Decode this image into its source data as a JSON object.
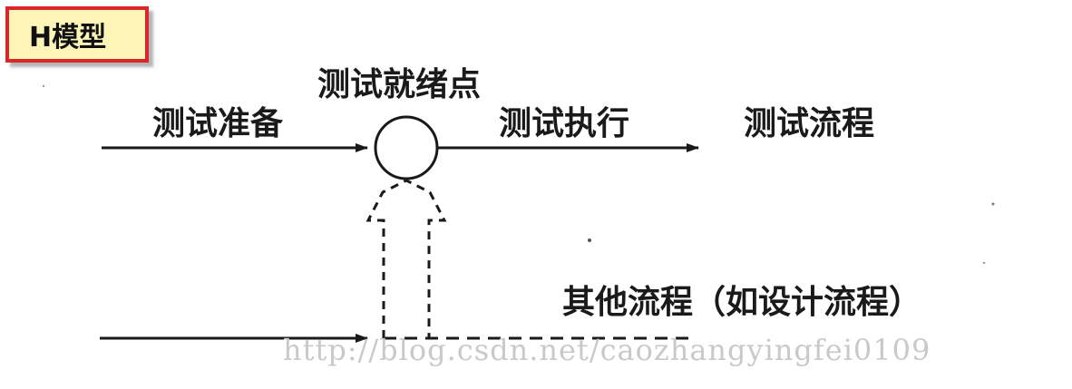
{
  "title": "H模型",
  "labels": {
    "test_ready_point": "测试就绪点",
    "test_prep": "测试准备",
    "test_exec": "测试执行",
    "test_flow": "测试流程",
    "other_flow": "其他流程（如设计流程）"
  },
  "watermark": "http://blog.csdn.net/caozhangyingfei0109",
  "colors": {
    "title_border": "#d8262a",
    "title_fill": "#fdf5b8",
    "line": "#1a1a1a",
    "watermark": "#c9c9c9"
  }
}
